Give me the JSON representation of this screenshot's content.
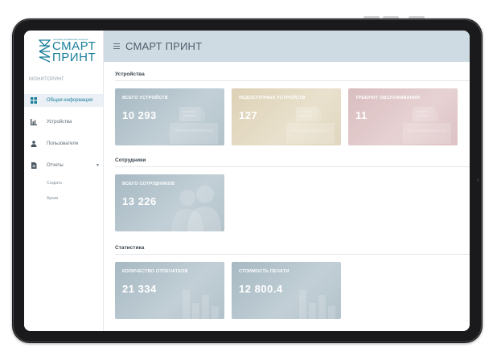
{
  "colors": {
    "accent": "#1a7f9a",
    "topbar": "#cfdbe3",
    "card_blue": "#b3c2ca",
    "card_beige": "#e0d6bf",
    "card_rose": "#dcc2c4"
  },
  "logo": {
    "line1": "СМАРТ",
    "line2": "ПРИНТ",
    "tagline": "система управления печатью"
  },
  "sidebar": {
    "brand_label": "МОНИТОРИНГ",
    "items": [
      {
        "label": "Общая информация",
        "icon": "dashboard-icon"
      },
      {
        "label": "Устройства",
        "icon": "bar-chart-icon"
      },
      {
        "label": "Пользователи",
        "icon": "users-icon"
      },
      {
        "label": "Отчеты",
        "icon": "document-icon"
      }
    ],
    "subitems": [
      {
        "label": "Создать"
      },
      {
        "label": "Архив"
      }
    ]
  },
  "header": {
    "title": "СМАРТ ПРИНТ"
  },
  "sections": {
    "devices": {
      "title": "Устройства",
      "cards": [
        {
          "label": "ВСЕГО УСТРОЙСТВ",
          "value": "10 293"
        },
        {
          "label": "НЕДОСТУПНЫХ УСТРОЙСТВ",
          "value": "127"
        },
        {
          "label": "ТРЕБУЮТ ОБСЛУЖИВАНИЯ",
          "value": "11"
        }
      ]
    },
    "employees": {
      "title": "Сотрудники",
      "cards": [
        {
          "label": "ВСЕГО СОТРУДНИКОВ",
          "value": "13 226"
        }
      ]
    },
    "statistics": {
      "title": "Статистика",
      "cards": [
        {
          "label": "КОЛИЧЕСТВО ОТПЕЧАТКОВ",
          "value": "21 334"
        },
        {
          "label": "СТОИМОСТЬ ПЕЧАТИ",
          "value": "12 800.4"
        }
      ]
    }
  }
}
